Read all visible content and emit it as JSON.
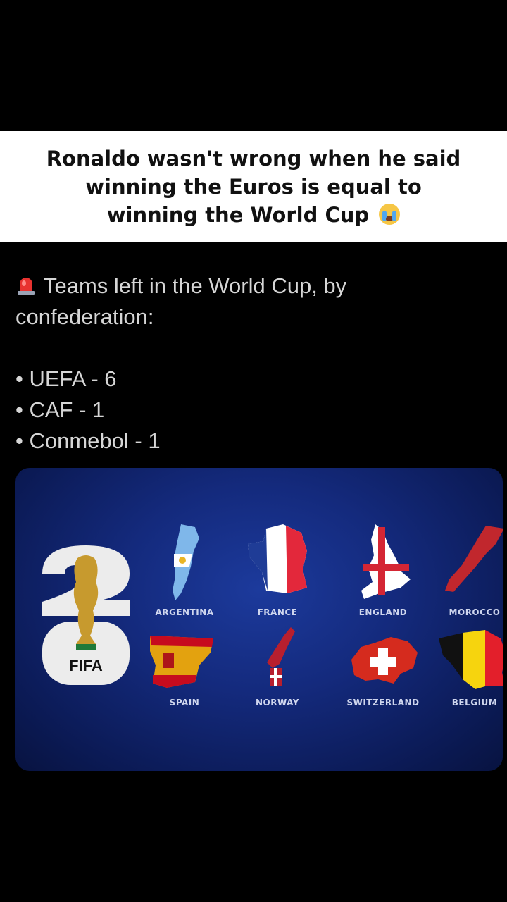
{
  "caption": {
    "line1": "Ronaldo wasn't wrong when he said",
    "line2": "winning the Euros is equal to",
    "line3": "winning the World Cup",
    "emoji": "crying-face-emoji"
  },
  "tweet": {
    "icon": "siren-icon",
    "heading_line1": "Teams left in the World Cup, by",
    "heading_line2": "confederation:",
    "bullets": [
      "• UEFA - 6",
      "• CAF - 1",
      "• Conmebol - 1"
    ]
  },
  "graphic": {
    "logo_text": "FIFA",
    "countries": [
      {
        "name": "ARGENTINA"
      },
      {
        "name": "FRANCE"
      },
      {
        "name": "ENGLAND"
      },
      {
        "name": "MOROCCO"
      },
      {
        "name": "SPAIN"
      },
      {
        "name": "NORWAY"
      },
      {
        "name": "SWITZERLAND"
      },
      {
        "name": "BELGIUM"
      }
    ],
    "colors": {
      "background": "#142a7d",
      "label": "#cfd6ee"
    }
  }
}
